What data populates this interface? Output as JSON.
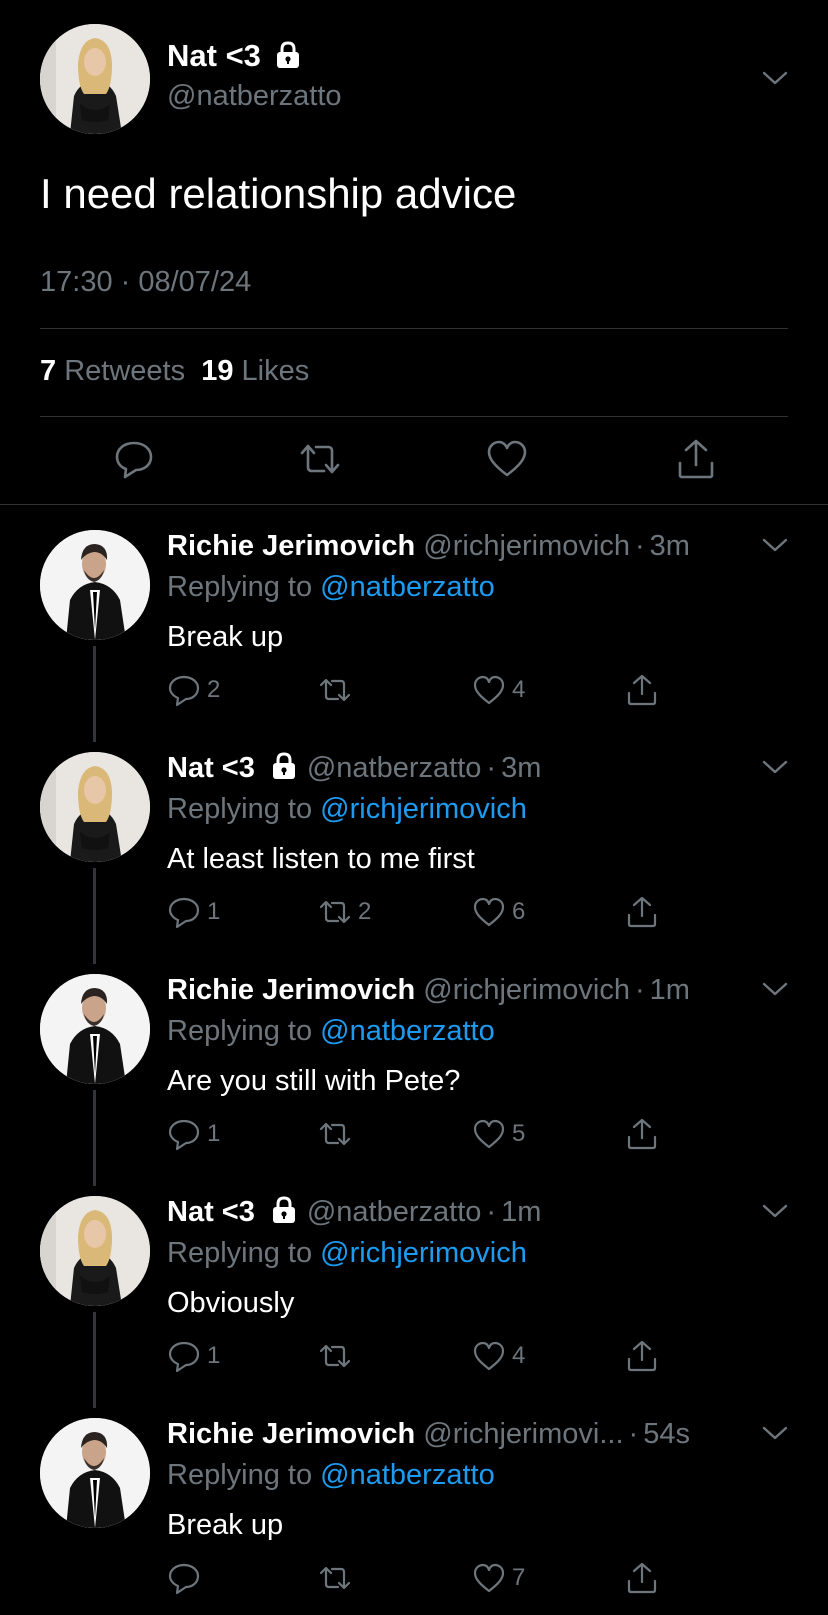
{
  "main_tweet": {
    "name": "Nat <3",
    "handle": "@natberzatto",
    "text": "I need relationship advice",
    "timestamp": "17:30 · 08/07/24",
    "retweets_count": "7",
    "retweets_label": "Retweets",
    "likes_count": "19",
    "likes_label": "Likes"
  },
  "replies": [
    {
      "name": "Richie Jerimovich",
      "handle": "@richjerimovich",
      "time": "3m",
      "replying_prefix": "Replying to",
      "replying_to": "@natberzatto",
      "text": "Break up",
      "reply_count": "2",
      "retweet_count": "",
      "like_count": "4"
    },
    {
      "name": "Nat <3",
      "handle": "@natberzatto",
      "time": "3m",
      "replying_prefix": "Replying to",
      "replying_to": "@richjerimovich",
      "text": "At least listen to me first",
      "reply_count": "1",
      "retweet_count": "2",
      "like_count": "6"
    },
    {
      "name": "Richie Jerimovich",
      "handle": "@richjerimovich",
      "time": "1m",
      "replying_prefix": "Replying to",
      "replying_to": "@natberzatto",
      "text": "Are you still with Pete?",
      "reply_count": "1",
      "retweet_count": "",
      "like_count": "5"
    },
    {
      "name": "Nat <3",
      "handle": "@natberzatto",
      "time": "1m",
      "replying_prefix": "Replying to",
      "replying_to": "@richjerimovich",
      "text": "Obviously",
      "reply_count": "1",
      "retweet_count": "",
      "like_count": "4"
    },
    {
      "name": "Richie Jerimovich",
      "handle": "@richjerimovi...",
      "time": "54s",
      "replying_prefix": "Replying to",
      "replying_to": "@natberzatto",
      "text": "Break up",
      "reply_count": "",
      "retweet_count": "",
      "like_count": "7"
    }
  ],
  "separator": "·",
  "colors": {
    "background": "#000000",
    "secondary_text": "#6e767d",
    "link": "#1d9bf0",
    "divider": "#2f3336"
  }
}
